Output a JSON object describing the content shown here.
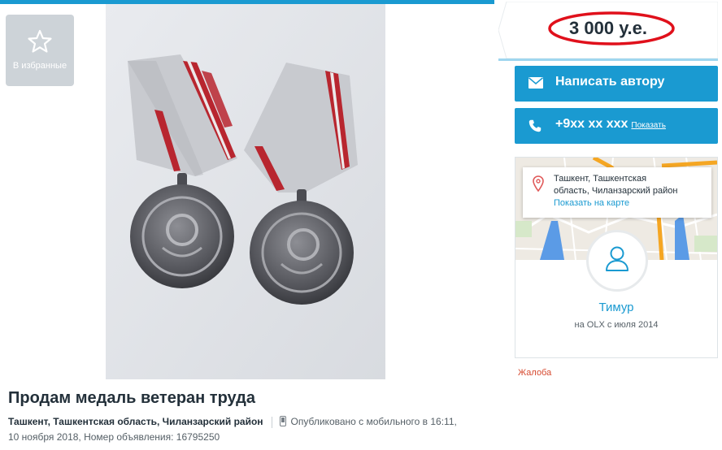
{
  "favorites": {
    "label": "В избранные",
    "icon": "star-icon"
  },
  "ad": {
    "title": "Продам медаль ветеран труда",
    "location": "Ташкент, Ташкентская область, Чиланзарский район",
    "published": "Опубликовано с мобильного  в 16:11,",
    "date_and_id": "10 ноября 2018, Номер объявления: 16795250",
    "photo": {
      "subject": "Две медали «Ветеран труда» на ленточных колодках"
    }
  },
  "price": {
    "value": "3 000 у.е."
  },
  "buttons": {
    "write_label": "Написать автору",
    "phone_label": "+9хх хх ххх",
    "phone_show": "Показать"
  },
  "seller": {
    "address_line1": "Ташкент, Ташкентская",
    "address_line2": "область, Чиланзарский район",
    "map_link": "Показать на карте",
    "name": "Тимур",
    "since": "на OLX с июля 2014"
  },
  "complaint": "Жалоба",
  "colors": {
    "accent": "#1a9ad1",
    "price_circle": "#e0101b",
    "complaint": "#d6492f"
  }
}
